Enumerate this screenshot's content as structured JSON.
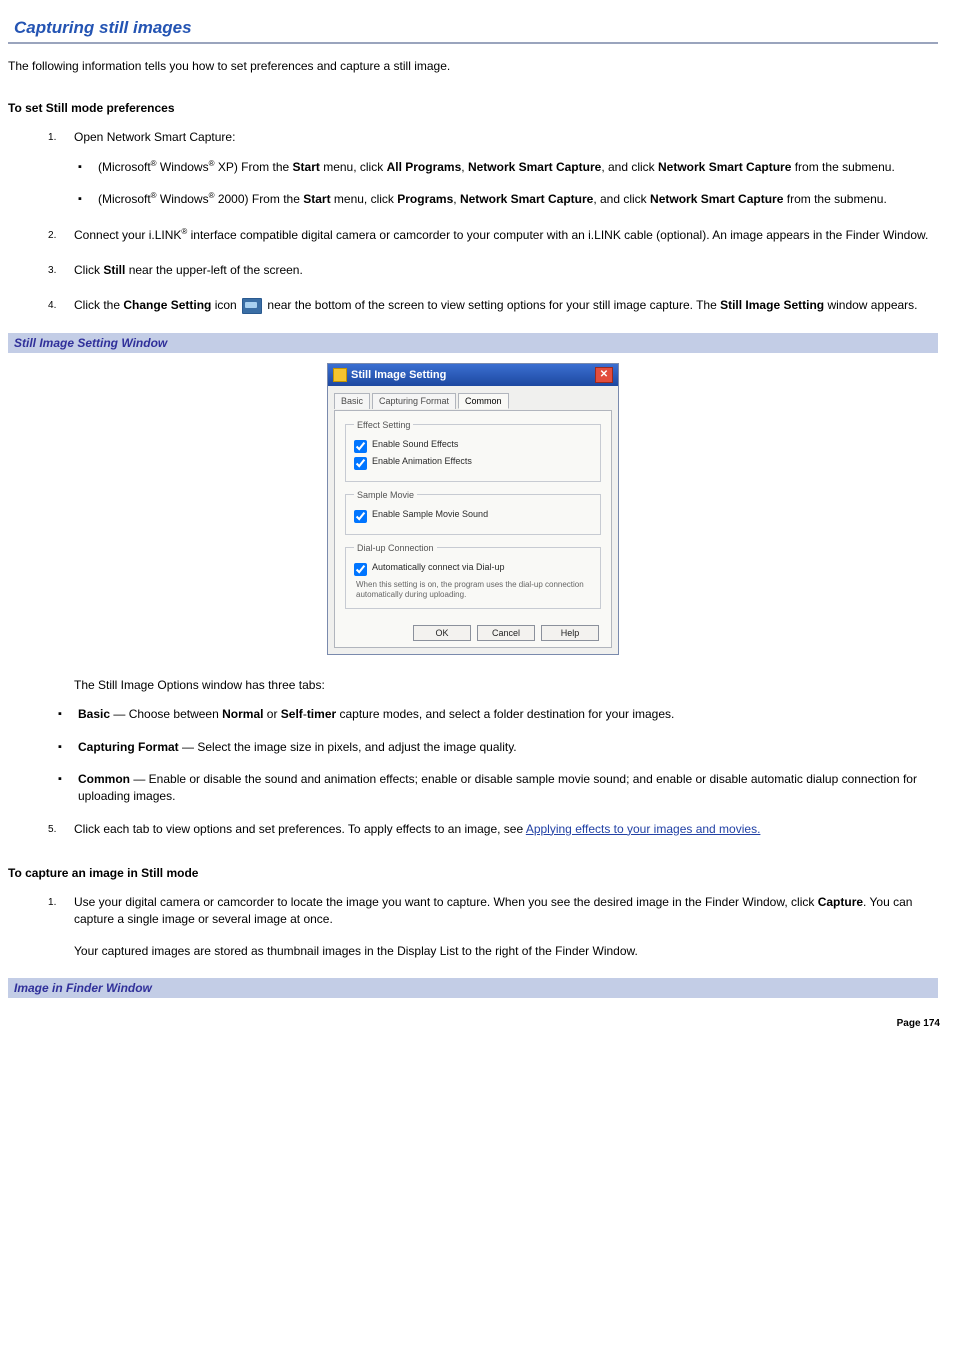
{
  "page": {
    "title": "Capturing still images",
    "intro": "The following information tells you how to set preferences and capture a still image."
  },
  "sect1": {
    "heading": "To set Still mode preferences",
    "step1": {
      "prefix": "Open Network Smart Capture:",
      "xp": {
        "a": "(Microsoft",
        "reg1": "®",
        "b": " Windows",
        "reg2": "®",
        "c": " XP) From the ",
        "strong1": "Start",
        "d": " menu, click ",
        "strong2": "All Programs",
        "e": ", ",
        "strong3": "Network Smart Capture",
        "f": ", and click ",
        "strong4": "Network Smart Capture",
        "g": " from the submenu."
      },
      "w2k": {
        "a": "(Microsoft",
        "reg1": "®",
        "b": " Windows",
        "reg2": "®",
        "c": " 2000) From the ",
        "strong1": "Start",
        "d": " menu, click ",
        "strong2": "Programs",
        "e": ", ",
        "strong3": "Network Smart Capture",
        "f": ", and click ",
        "strong4": "Network Smart Capture",
        "g": " from the submenu."
      }
    },
    "step2": {
      "a": "Connect your i.LINK",
      "reg": "®",
      "b": " interface compatible digital camera or camcorder to your computer with an i.LINK cable (optional). An image appears in the Finder Window."
    },
    "step3": {
      "a": "Click ",
      "strong1": "Still",
      "b": " near the upper-left of the screen."
    },
    "step4": {
      "a": "Click the ",
      "strong1": "Change Setting",
      "b": " icon ",
      "c": " near the bottom of the screen to view setting options for your still image capture. The ",
      "strong2": "Still Image Setting",
      "d": " window appears."
    },
    "caption1": "Still Image Setting Window",
    "tabs_intro": "The Still Image Options window has three tabs:",
    "tabs": {
      "basic": {
        "name": "Basic",
        "sep": " — ",
        "t1": "Choose between ",
        "strong1": "Normal",
        "t2": " or ",
        "strong2": "Self",
        "dash": "-",
        "strong3": "timer",
        "t3": " capture modes, and select a folder destination for your images."
      },
      "format": {
        "name": "Capturing Format",
        "sep": " — ",
        "t": "Select the image size in pixels, and adjust the image quality."
      },
      "common": {
        "name": "Common",
        "sep": " — ",
        "t": "Enable or disable the sound and animation effects; enable or disable sample movie sound; and enable or disable automatic dialup connection for uploading images."
      }
    },
    "step5": {
      "a": "Click each tab to view options and set preferences. To apply effects to an image, see ",
      "link": "Applying effects to your images and movies."
    }
  },
  "sect2": {
    "heading": "To capture an image in Still mode",
    "step1": {
      "a": "Use your digital camera or camcorder to locate the image you want to capture. When you see the desired image in the Finder Window, click ",
      "strong1": "Capture",
      "b": ". You can capture a single image or several image at once.",
      "note": "Your captured images are stored as thumbnail images in the Display List to the right of the Finder Window."
    },
    "caption2": "Image in Finder Window"
  },
  "dialog": {
    "title": "Still Image Setting",
    "tabs": {
      "t0": "Basic",
      "t1": "Capturing Format",
      "t2": "Common"
    },
    "group1": {
      "legend": "Effect Setting",
      "chk1": "Enable Sound Effects",
      "chk2": "Enable Animation Effects"
    },
    "group2": {
      "legend": "Sample Movie",
      "chk1": "Enable Sample Movie Sound"
    },
    "group3": {
      "legend": "Dial-up Connection",
      "chk1": "Automatically connect via Dial-up",
      "note": "When this setting is on, the program uses the dial-up connection automatically during uploading."
    },
    "buttons": {
      "ok": "OK",
      "cancel": "Cancel",
      "help": "Help"
    }
  },
  "footer": {
    "label": "Page 174"
  }
}
